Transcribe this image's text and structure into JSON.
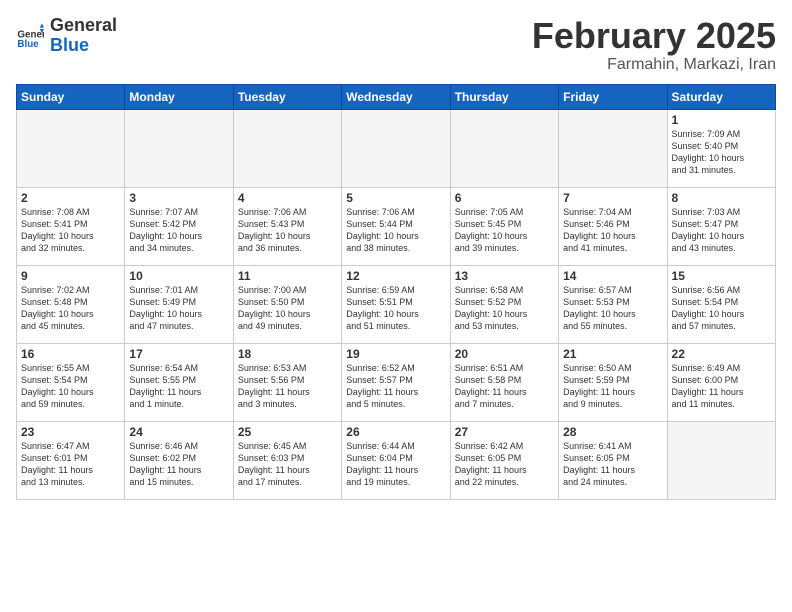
{
  "header": {
    "logo_line1": "General",
    "logo_line2": "Blue",
    "title": "February 2025",
    "subtitle": "Farmahin, Markazi, Iran"
  },
  "days_of_week": [
    "Sunday",
    "Monday",
    "Tuesday",
    "Wednesday",
    "Thursday",
    "Friday",
    "Saturday"
  ],
  "weeks": [
    [
      {
        "day": "",
        "info": ""
      },
      {
        "day": "",
        "info": ""
      },
      {
        "day": "",
        "info": ""
      },
      {
        "day": "",
        "info": ""
      },
      {
        "day": "",
        "info": ""
      },
      {
        "day": "",
        "info": ""
      },
      {
        "day": "1",
        "info": "Sunrise: 7:09 AM\nSunset: 5:40 PM\nDaylight: 10 hours\nand 31 minutes."
      }
    ],
    [
      {
        "day": "2",
        "info": "Sunrise: 7:08 AM\nSunset: 5:41 PM\nDaylight: 10 hours\nand 32 minutes."
      },
      {
        "day": "3",
        "info": "Sunrise: 7:07 AM\nSunset: 5:42 PM\nDaylight: 10 hours\nand 34 minutes."
      },
      {
        "day": "4",
        "info": "Sunrise: 7:06 AM\nSunset: 5:43 PM\nDaylight: 10 hours\nand 36 minutes."
      },
      {
        "day": "5",
        "info": "Sunrise: 7:06 AM\nSunset: 5:44 PM\nDaylight: 10 hours\nand 38 minutes."
      },
      {
        "day": "6",
        "info": "Sunrise: 7:05 AM\nSunset: 5:45 PM\nDaylight: 10 hours\nand 39 minutes."
      },
      {
        "day": "7",
        "info": "Sunrise: 7:04 AM\nSunset: 5:46 PM\nDaylight: 10 hours\nand 41 minutes."
      },
      {
        "day": "8",
        "info": "Sunrise: 7:03 AM\nSunset: 5:47 PM\nDaylight: 10 hours\nand 43 minutes."
      }
    ],
    [
      {
        "day": "9",
        "info": "Sunrise: 7:02 AM\nSunset: 5:48 PM\nDaylight: 10 hours\nand 45 minutes."
      },
      {
        "day": "10",
        "info": "Sunrise: 7:01 AM\nSunset: 5:49 PM\nDaylight: 10 hours\nand 47 minutes."
      },
      {
        "day": "11",
        "info": "Sunrise: 7:00 AM\nSunset: 5:50 PM\nDaylight: 10 hours\nand 49 minutes."
      },
      {
        "day": "12",
        "info": "Sunrise: 6:59 AM\nSunset: 5:51 PM\nDaylight: 10 hours\nand 51 minutes."
      },
      {
        "day": "13",
        "info": "Sunrise: 6:58 AM\nSunset: 5:52 PM\nDaylight: 10 hours\nand 53 minutes."
      },
      {
        "day": "14",
        "info": "Sunrise: 6:57 AM\nSunset: 5:53 PM\nDaylight: 10 hours\nand 55 minutes."
      },
      {
        "day": "15",
        "info": "Sunrise: 6:56 AM\nSunset: 5:54 PM\nDaylight: 10 hours\nand 57 minutes."
      }
    ],
    [
      {
        "day": "16",
        "info": "Sunrise: 6:55 AM\nSunset: 5:54 PM\nDaylight: 10 hours\nand 59 minutes."
      },
      {
        "day": "17",
        "info": "Sunrise: 6:54 AM\nSunset: 5:55 PM\nDaylight: 11 hours\nand 1 minute."
      },
      {
        "day": "18",
        "info": "Sunrise: 6:53 AM\nSunset: 5:56 PM\nDaylight: 11 hours\nand 3 minutes."
      },
      {
        "day": "19",
        "info": "Sunrise: 6:52 AM\nSunset: 5:57 PM\nDaylight: 11 hours\nand 5 minutes."
      },
      {
        "day": "20",
        "info": "Sunrise: 6:51 AM\nSunset: 5:58 PM\nDaylight: 11 hours\nand 7 minutes."
      },
      {
        "day": "21",
        "info": "Sunrise: 6:50 AM\nSunset: 5:59 PM\nDaylight: 11 hours\nand 9 minutes."
      },
      {
        "day": "22",
        "info": "Sunrise: 6:49 AM\nSunset: 6:00 PM\nDaylight: 11 hours\nand 11 minutes."
      }
    ],
    [
      {
        "day": "23",
        "info": "Sunrise: 6:47 AM\nSunset: 6:01 PM\nDaylight: 11 hours\nand 13 minutes."
      },
      {
        "day": "24",
        "info": "Sunrise: 6:46 AM\nSunset: 6:02 PM\nDaylight: 11 hours\nand 15 minutes."
      },
      {
        "day": "25",
        "info": "Sunrise: 6:45 AM\nSunset: 6:03 PM\nDaylight: 11 hours\nand 17 minutes."
      },
      {
        "day": "26",
        "info": "Sunrise: 6:44 AM\nSunset: 6:04 PM\nDaylight: 11 hours\nand 19 minutes."
      },
      {
        "day": "27",
        "info": "Sunrise: 6:42 AM\nSunset: 6:05 PM\nDaylight: 11 hours\nand 22 minutes."
      },
      {
        "day": "28",
        "info": "Sunrise: 6:41 AM\nSunset: 6:05 PM\nDaylight: 11 hours\nand 24 minutes."
      },
      {
        "day": "",
        "info": ""
      }
    ]
  ]
}
